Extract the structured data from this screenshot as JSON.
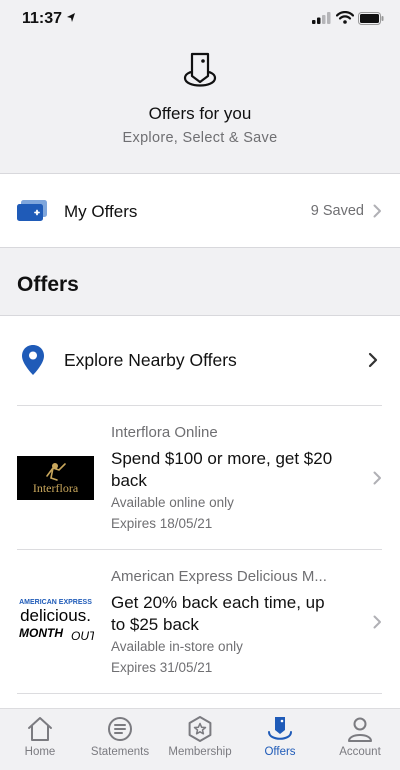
{
  "status_bar": {
    "time": "11:37"
  },
  "header": {
    "title": "Offers for you",
    "subtitle": "Explore, Select & Save"
  },
  "my_offers": {
    "label": "My Offers",
    "saved": "9 Saved"
  },
  "section": {
    "title": "Offers"
  },
  "nearby": {
    "label": "Explore Nearby Offers"
  },
  "offers": [
    {
      "merchant": "Interflora Online",
      "title": "Spend $100 or more, get $20 back",
      "availability": "Available online only",
      "expiry": "Expires 18/05/21",
      "logo_text": "Interflora"
    },
    {
      "merchant": "American Express Delicious M...",
      "title": "Get 20% back each time, up to $25 back",
      "availability": "Available in-store only",
      "expiry": "Expires 31/05/21",
      "logo_brand": "AMERICAN EXPRESS",
      "logo_word": "delicious.",
      "logo_month": "MONTH",
      "logo_out": "OUT"
    }
  ],
  "tabs": [
    {
      "label": "Home",
      "icon": "home-icon"
    },
    {
      "label": "Statements",
      "icon": "statements-icon"
    },
    {
      "label": "Membership",
      "icon": "membership-icon"
    },
    {
      "label": "Offers",
      "icon": "offers-icon",
      "active": true
    },
    {
      "label": "Account",
      "icon": "account-icon"
    }
  ],
  "colors": {
    "accent": "#1f5bb8",
    "background": "#f1f1f3",
    "muted": "#6f6f72"
  }
}
